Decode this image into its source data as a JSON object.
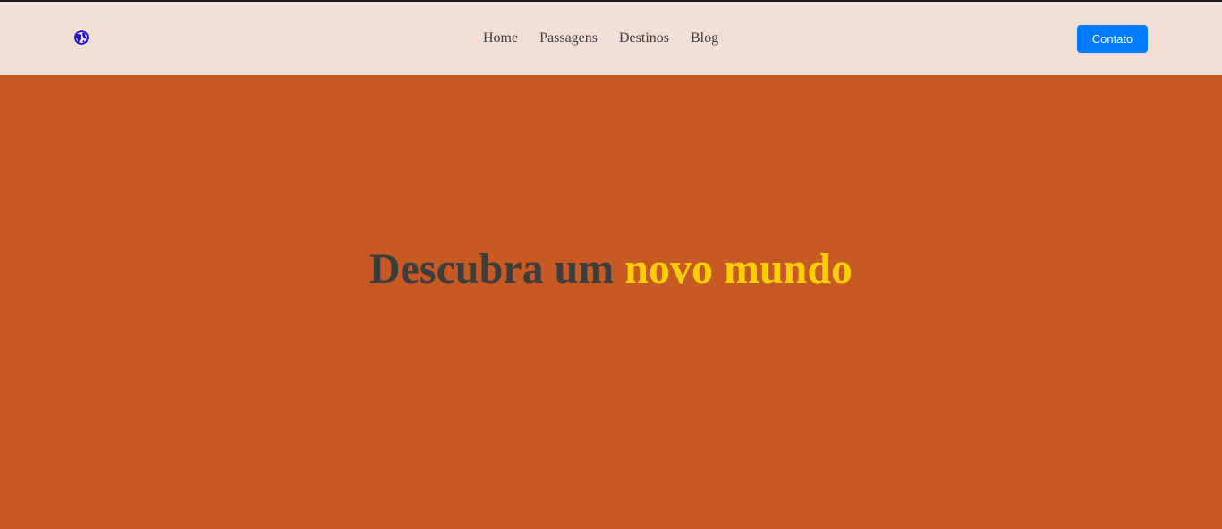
{
  "colors": {
    "navbar_bg": "#f3ded6",
    "hero_bg": "#c75922",
    "text_dark": "#3d3d3d",
    "highlight": "#fcd000",
    "button_bg": "#007bff",
    "logo_color": "#1a10e0"
  },
  "header": {
    "logo_icon": "globe-icon",
    "nav": [
      {
        "label": "Home"
      },
      {
        "label": "Passagens"
      },
      {
        "label": "Destinos"
      },
      {
        "label": "Blog"
      }
    ],
    "contact_label": "Contato"
  },
  "hero": {
    "title_prefix": "Descubra um ",
    "title_highlight": "novo mundo"
  }
}
